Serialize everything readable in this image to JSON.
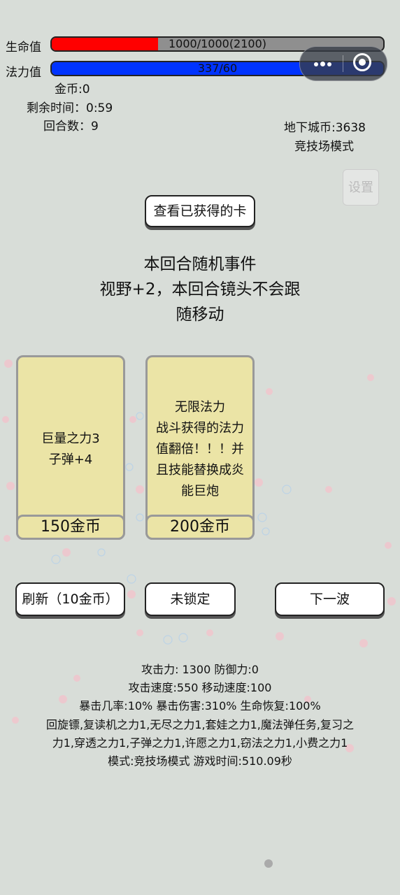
{
  "hud": {
    "hp_label": "生命值",
    "hp_text": "1000/1000(2100)",
    "hp_fill": 0.32,
    "hp_color": "#ff0000",
    "mp_label": "法力值",
    "mp_text": "337/60",
    "mp_fill": 1.0,
    "mp_color": "#0033ff",
    "gold": "金币:0",
    "time_left": "剩余时间：0:59",
    "round": "回合数：9",
    "dungeon_coins": "地下城币:3638",
    "mode": "竞技场模式"
  },
  "settings_label": "设置",
  "view_cards_label": "查看已获得的卡",
  "event": {
    "title": "本回合随机事件",
    "line1": "视野+2，本回合镜头不会跟",
    "line2": "随移动"
  },
  "cards": [
    {
      "lines": [
        "巨量之力3",
        "子弹+4"
      ],
      "price": "150金币"
    },
    {
      "lines": [
        "无限法力",
        "战斗获得的法力",
        "值翻倍！！！并",
        "且技能替换成炎",
        "能巨炮"
      ],
      "price": "200金币"
    }
  ],
  "actions": {
    "refresh": "刷新（10金币）",
    "lock": "未锁定",
    "next": "下一波"
  },
  "stats": {
    "line1": "攻击力:  1300 防御力:0",
    "line2": "攻击速度:550 移动速度:100",
    "line3": "暴击几率:10% 暴击伤害:310% 生命恢复:100%",
    "line4": "回旋镖,复读机之力1,无尽之力1,套娃之力1,魔法弹任务,复习之",
    "line5": "力1,穿透之力1,子弹之力1,许愿之力1,窃法之力1,小费之力1",
    "line6": "模式:竞技场模式 游戏时间:510.09秒"
  }
}
